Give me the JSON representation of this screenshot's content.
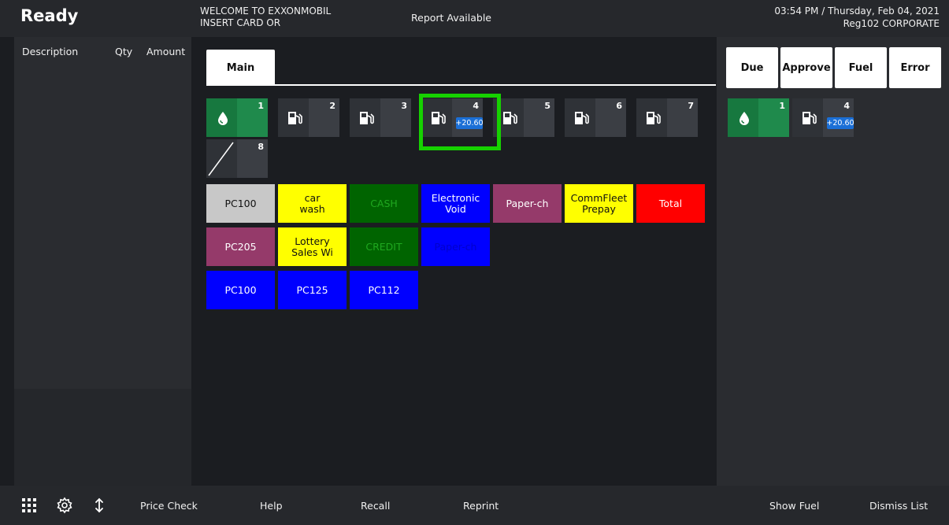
{
  "header": {
    "status": "Ready",
    "welcome_line1": "WELCOME TO EXXONMOBIL",
    "welcome_line2": "INSERT CARD OR",
    "report": "Report Available",
    "datetime": "03:54 PM / Thursday, Feb 04, 2021",
    "register": "Reg102  CORPORATE"
  },
  "receipt": {
    "col_description": "Description",
    "col_qty": "Qty",
    "col_amount": "Amount"
  },
  "tabs": {
    "main": "Main"
  },
  "pumps": [
    {
      "num": "1",
      "icon": "drop-icon",
      "amount": ""
    },
    {
      "num": "2",
      "icon": "fuel-pump-icon",
      "amount": ""
    },
    {
      "num": "3",
      "icon": "fuel-pump-icon",
      "amount": ""
    },
    {
      "num": "4",
      "icon": "fuel-pump-icon",
      "amount": "+20.60"
    },
    {
      "num": "5",
      "icon": "fuel-pump-icon",
      "amount": ""
    },
    {
      "num": "6",
      "icon": "fuel-pump-icon",
      "amount": ""
    },
    {
      "num": "7",
      "icon": "fuel-pump-icon",
      "amount": ""
    },
    {
      "num": "8",
      "icon": "offline-slash-icon",
      "amount": ""
    }
  ],
  "keys": [
    {
      "label": "PC100",
      "bg": "#c8c8c8",
      "fg": "#111111"
    },
    {
      "label": "car\nwash",
      "bg": "#ffff00",
      "fg": "#111111"
    },
    {
      "label": "CASH",
      "bg": "#006400",
      "fg": "#1fa81f"
    },
    {
      "label": "Electronic\nVoid",
      "bg": "#0000ff",
      "fg": "#ffffff"
    },
    {
      "label": "Paper-ch",
      "bg": "#953a6a",
      "fg": "#ffffff"
    },
    {
      "label": "CommFleet\nPrepay",
      "bg": "#ffff00",
      "fg": "#111111"
    },
    {
      "label": "Total",
      "bg": "#ff0000",
      "fg": "#ffffff"
    },
    {
      "label": "PC205",
      "bg": "#953a6a",
      "fg": "#ffffff"
    },
    {
      "label": "Lottery\nSales Wi",
      "bg": "#ffff00",
      "fg": "#111111"
    },
    {
      "label": "CREDIT",
      "bg": "#006400",
      "fg": "#1fa81f"
    },
    {
      "label": "Paper-ch",
      "bg": "#0000ff",
      "fg": "#0000cc"
    },
    {
      "label": "PC100",
      "bg": "#0000ff",
      "fg": "#ffffff"
    },
    {
      "label": "PC125",
      "bg": "#0000ff",
      "fg": "#ffffff"
    },
    {
      "label": "PC112",
      "bg": "#0000ff",
      "fg": "#ffffff"
    }
  ],
  "right_tabs": [
    "Due",
    "Approve",
    "Fuel",
    "Error"
  ],
  "right_pumps": [
    {
      "num": "1",
      "icon": "drop-icon",
      "amount": ""
    },
    {
      "num": "4",
      "icon": "fuel-pump-icon",
      "amount": "+20.60"
    }
  ],
  "footer": {
    "price_check": "Price Check",
    "help": "Help",
    "recall": "Recall",
    "reprint": "Reprint",
    "show_fuel": "Show Fuel",
    "dismiss_list": "Dismiss List",
    "icons": [
      "grid-menu-icon",
      "gear-icon",
      "up-down-arrow-icon"
    ]
  },
  "colors": {
    "highlight": "#16d100",
    "active_pump": "#1f8a4c",
    "amount_badge": "#1b6fd6"
  }
}
